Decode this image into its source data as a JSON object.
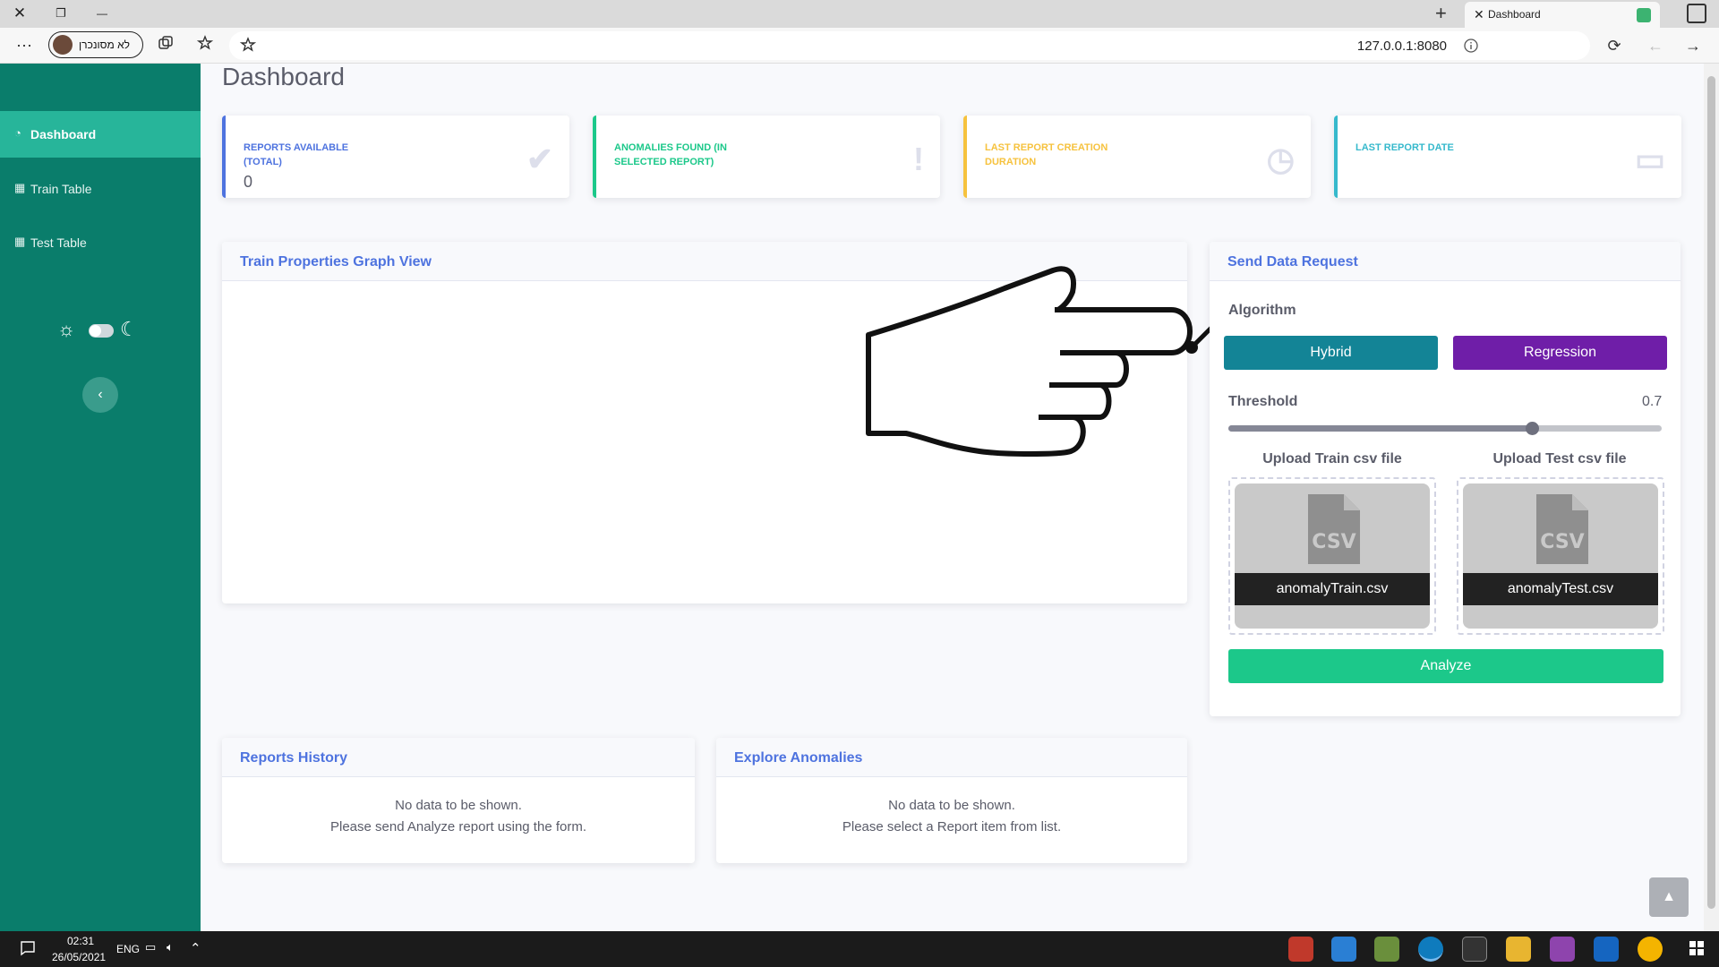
{
  "browser": {
    "tab_title": "Dashboard",
    "new_tab_symbol": "+",
    "close_symbol": "✕",
    "restore_symbol": "❐",
    "minimize_symbol": "—",
    "profile_label": "לא מסונכרן",
    "url": "127.0.0.1:8080",
    "menu_symbol": "⋯",
    "refresh_symbol": "⟳",
    "back_symbol": "←",
    "forward_symbol": "→"
  },
  "sidebar": {
    "items": [
      {
        "label": "Dashboard",
        "icon": "gauge-icon",
        "glyph": "◔",
        "active": true
      },
      {
        "label": "Train Table",
        "icon": "table-icon",
        "glyph": "▦",
        "active": false
      },
      {
        "label": "Test Table",
        "icon": "table-icon",
        "glyph": "▦",
        "active": false
      }
    ],
    "theme": {
      "sun_glyph": "☼",
      "moon_glyph": "☾"
    },
    "collapse_glyph": "‹"
  },
  "main": {
    "page_title": "Dashboard",
    "stats": [
      {
        "label": "REPORTS AVAILABLE (TOTAL)",
        "value": "0",
        "color": "#4e73df",
        "icon": "check-icon",
        "glyph": "✔"
      },
      {
        "label": "ANOMALIES FOUND (IN SELECTED REPORT)",
        "value": "",
        "color": "#1cc88a",
        "icon": "exclamation-icon",
        "glyph": "!"
      },
      {
        "label": "LAST REPORT CREATION DURATION",
        "value": "",
        "color": "#f6c23e",
        "icon": "clock-icon",
        "glyph": "◷"
      },
      {
        "label": "LAST REPORT DATE",
        "value": "",
        "color": "#36b9cc",
        "icon": "calendar-icon",
        "glyph": "▭"
      }
    ],
    "graph_panel": {
      "title": "Train Properties Graph View"
    },
    "send_panel": {
      "title": "Send Data Request",
      "algorithm_label": "Algorithm",
      "algorithms": [
        {
          "label": "Hybrid",
          "color": "#138496"
        },
        {
          "label": "Regression",
          "color": "#6f1ea8"
        }
      ],
      "threshold_label": "Threshold",
      "threshold_value": "0.7",
      "threshold_fraction": 0.7,
      "upload_train_label": "Upload Train csv file",
      "upload_test_label": "Upload Test csv file",
      "train_file": "anomalyTrain.csv",
      "test_file": "anomalyTest.csv",
      "csv_badge": "CSV",
      "analyze_label": "Analyze"
    },
    "history_panel": {
      "title": "Reports History",
      "line1": "No data to be shown.",
      "line2": "Please send Analyze report using the form."
    },
    "anomalies_panel": {
      "title": "Explore Anomalies",
      "line1": "No data to be shown.",
      "line2": "Please select a Report item from list."
    },
    "scroll_top_glyph": "▲"
  },
  "taskbar": {
    "time": "02:31",
    "date": "26/05/2021",
    "language": "ENG",
    "tray_up_glyph": "⌃",
    "volume_glyph": "🔈︎",
    "network_glyph": "▭"
  }
}
